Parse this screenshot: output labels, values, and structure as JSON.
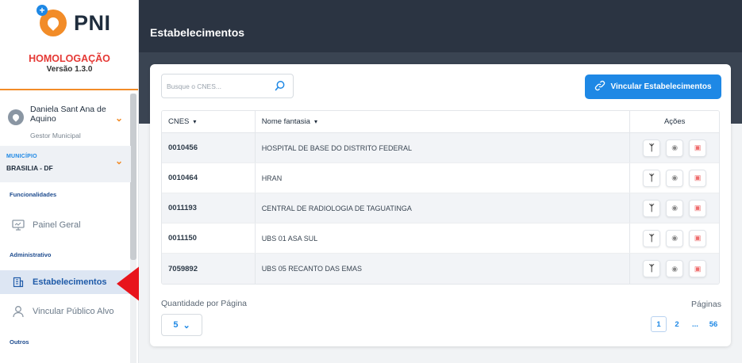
{
  "sidebar": {
    "logo_text": "PNI",
    "environment": "HOMOLOGAÇÃO",
    "version": "Versão 1.3.0",
    "user": {
      "name": "Daniela Sant Ana de Aquino",
      "role": "Gestor Municipal"
    },
    "municipio": {
      "label": "MUNICÍPIO",
      "value": "BRASILIA - DF"
    },
    "sections": {
      "funcionalidades": "Funcionalidades",
      "administrativo": "Administrativo",
      "outros": "Outros"
    },
    "items": {
      "painel": "Painel Geral",
      "estabelecimentos": "Estabelecimentos",
      "vincular_publico": "Vincular Público Alvo"
    }
  },
  "header": {
    "title": "Estabelecimentos"
  },
  "toolbar": {
    "search_placeholder": "Busque o CNES...",
    "vincular_label": "Vincular Estabelecimentos"
  },
  "table": {
    "columns": [
      "CNES",
      "Nome fantasia",
      "Ações"
    ],
    "rows": [
      {
        "cnes": "0010456",
        "nome": "HOSPITAL DE BASE DO DISTRITO FEDERAL"
      },
      {
        "cnes": "0010464",
        "nome": "HRAN"
      },
      {
        "cnes": "0011193",
        "nome": "CENTRAL DE RADIOLOGIA DE TAGUATINGA"
      },
      {
        "cnes": "0011150",
        "nome": "UBS 01 ASA SUL"
      },
      {
        "cnes": "7059892",
        "nome": "UBS 05 RECANTO DAS EMAS"
      }
    ]
  },
  "footer": {
    "qty_label": "Quantidade por Página",
    "qty_value": "5",
    "pages_label": "Páginas",
    "pages": [
      "1",
      "2",
      "...",
      "56"
    ],
    "current_page": "1"
  },
  "colors": {
    "primary": "#1e88e5",
    "brand_orange": "#f28c28",
    "danger": "#e53935",
    "header_dark": "#2b3442"
  }
}
